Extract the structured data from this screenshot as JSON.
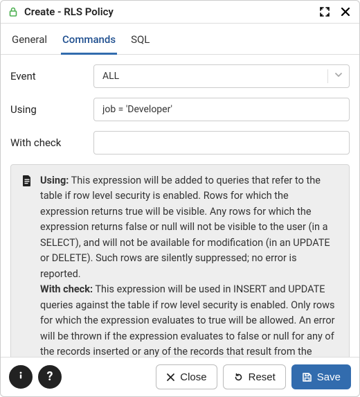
{
  "dialog": {
    "title": "Create - RLS Policy"
  },
  "tabs": {
    "general": "General",
    "commands": "Commands",
    "sql": "SQL"
  },
  "form": {
    "event_label": "Event",
    "event_value": "ALL",
    "using_label": "Using",
    "using_value": "job = 'Developer'",
    "withcheck_label": "With check",
    "withcheck_value": ""
  },
  "help": {
    "using_label": "Using:",
    "using_text": " This expression will be added to queries that refer to the table if row level security is enabled. Rows for which the expression returns true will be visible. Any rows for which the expression returns false or null will not be visible to the user (in a SELECT), and will not be available for modification (in an UPDATE or DELETE). Such rows are silently suppressed; no error is reported.",
    "withcheck_label": "With check:",
    "withcheck_text": " This expression will be used in INSERT and UPDATE queries against the table if row level security is enabled. Only rows for which the expression evaluates to true will be allowed. An error will be thrown if the expression evaluates to false or null for any of the records inserted or any of the records that result from the update."
  },
  "footer": {
    "close": "Close",
    "reset": "Reset",
    "save": "Save"
  }
}
